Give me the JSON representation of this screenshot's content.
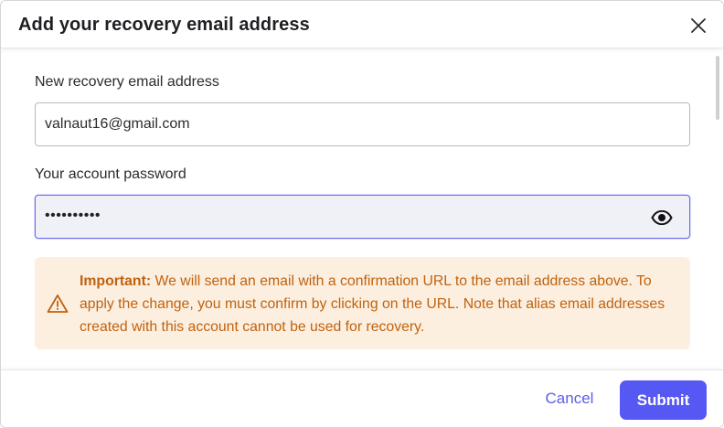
{
  "dialog": {
    "title": "Add your recovery email address",
    "close_icon": "close-icon"
  },
  "form": {
    "email_label": "New recovery email address",
    "email_value": "valnaut16@gmail.com",
    "password_label": "Your account password",
    "password_masked": "••••••••••",
    "show_password_icon": "eye-icon"
  },
  "notice": {
    "icon": "warning-icon",
    "emphasis": "Important:",
    "text": " We will send an email with a confirmation URL to the email address above. To apply the change, you must confirm by clicking on the URL. Note that alias email addresses created with this account cannot be used for recovery."
  },
  "footer": {
    "cancel_label": "Cancel",
    "submit_label": "Submit"
  },
  "colors": {
    "accent": "#5558f2",
    "link": "#5b5ee8",
    "notice_bg": "#fcefe0",
    "notice_text": "#c0620e",
    "focused_input_bg": "#f0f0f7"
  }
}
